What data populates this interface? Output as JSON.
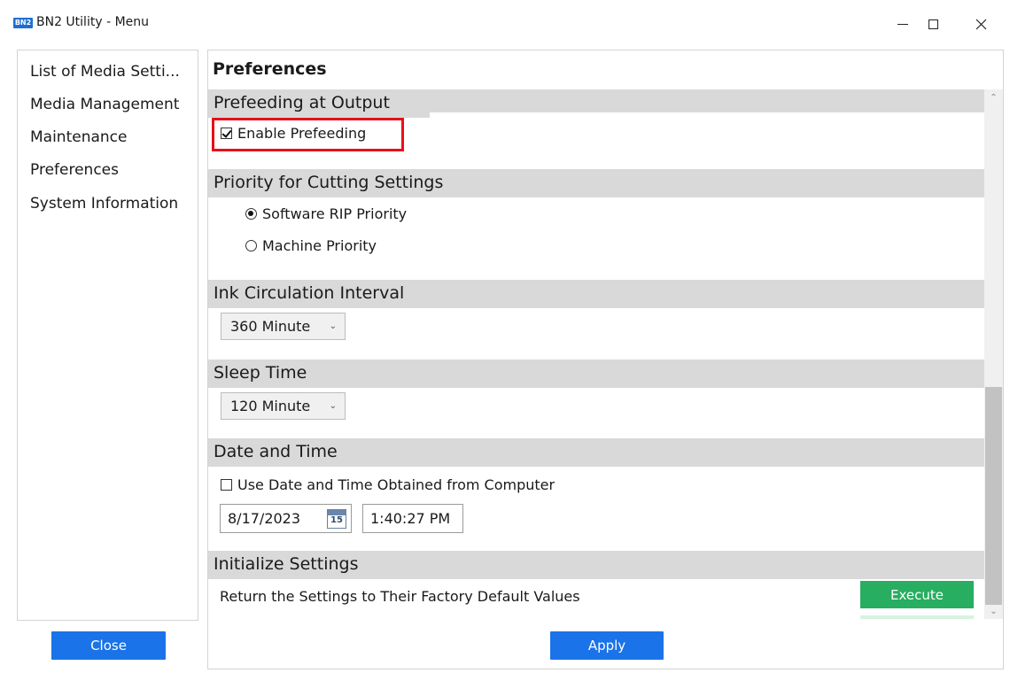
{
  "window": {
    "logo_text": "BN2",
    "title": "BN2 Utility - Menu",
    "minimize_icon": "minimize-icon",
    "maximize_icon": "maximize-icon",
    "close_icon": "close-icon"
  },
  "sidebar": {
    "items": [
      {
        "label": "List of Media Setti..."
      },
      {
        "label": "Media Management"
      },
      {
        "label": "Maintenance"
      },
      {
        "label": "Preferences"
      },
      {
        "label": "System Information"
      }
    ],
    "close_label": "Close"
  },
  "main": {
    "title": "Preferences",
    "sections": {
      "prefeeding": {
        "header": "Prefeeding at Output",
        "enable_label": "Enable Prefeeding",
        "enable_checked": true
      },
      "cutting": {
        "header": "Priority for Cutting Settings",
        "options": [
          {
            "label": "Software RIP Priority",
            "selected": true
          },
          {
            "label": "Machine Priority",
            "selected": false
          }
        ]
      },
      "ink": {
        "header": "Ink Circulation Interval",
        "value": "360 Minute"
      },
      "sleep": {
        "header": "Sleep Time",
        "value": "120 Minute"
      },
      "datetime": {
        "header": "Date and Time",
        "use_computer_label": "Use Date and Time Obtained from Computer",
        "use_computer_checked": false,
        "date": "8/17/2023",
        "calendar_day": "15",
        "time": "1:40:27 PM"
      },
      "initialize": {
        "header": "Initialize Settings",
        "description": "Return the Settings to Their Factory Default Values",
        "execute_label": "Execute"
      }
    },
    "apply_label": "Apply"
  },
  "colors": {
    "primary_button": "#1a73e8",
    "execute_button": "#27ae60",
    "highlight": "#e8101a",
    "section_header": "#d9d9d9"
  }
}
